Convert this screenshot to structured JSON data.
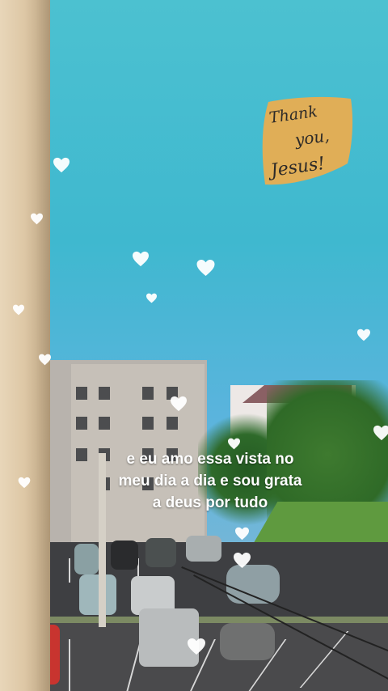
{
  "sticker": {
    "line1": "Thank",
    "line2": "you,",
    "line3": "Jesus!",
    "background_color": "#e0ae57",
    "text_color": "#2d2a28"
  },
  "caption": {
    "lines": [
      "e eu amo essa vista no",
      "meu dia a dia e sou grata",
      "a deus por tudo"
    ],
    "color": "#ffffff"
  },
  "decoration": {
    "icon": "heart-icon",
    "color": "#ffffff"
  },
  "colors": {
    "sky": "#3fb8cf",
    "wall": "#e0cfb3",
    "asphalt": "#3e3f42"
  }
}
